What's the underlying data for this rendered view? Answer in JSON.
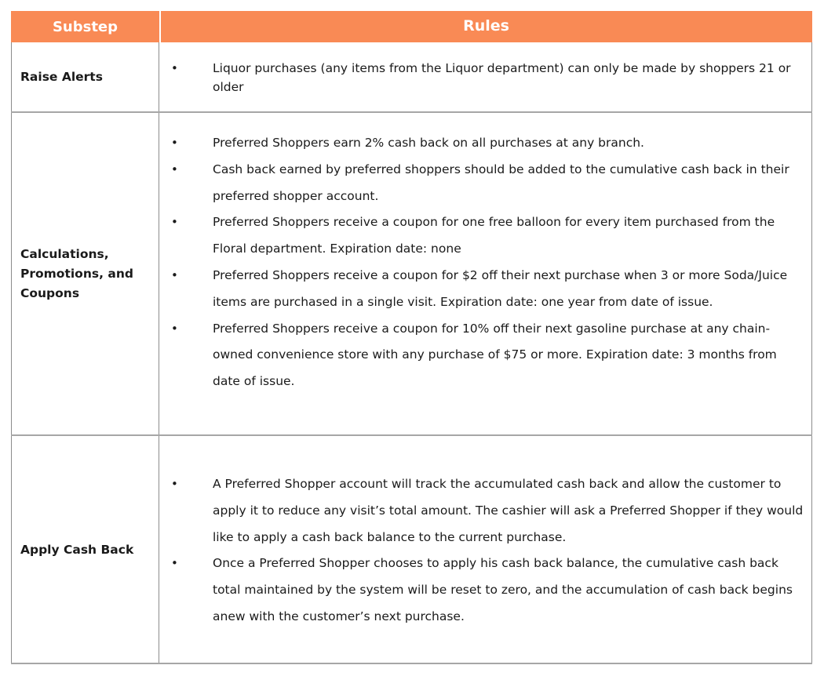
{
  "header": {
    "substep": "Substep",
    "rules": "Rules"
  },
  "rows": [
    {
      "substep": "Raise Alerts",
      "rules": [
        "Liquor purchases (any items from the Liquor department) can only be made by shoppers 21 or older"
      ]
    },
    {
      "substep": "Calculations, Promotions, and Coupons",
      "rules": [
        "Preferred Shoppers earn 2% cash back on all purchases at any branch.",
        "Cash back earned by preferred shoppers should be added to the cumulative cash back in their preferred shopper account.",
        "Preferred Shoppers receive a coupon for one free balloon for every item purchased from the Floral department. Expiration date: none",
        "Preferred Shoppers receive a coupon for $2 off their next purchase when 3 or more Soda/Juice items are purchased in a single visit. Expiration date: one year from date of issue.",
        "Preferred Shoppers receive a coupon for 10% off their next gasoline purchase at any chain-owned convenience store with any purchase of $75 or more. Expiration date: 3 months from date of issue."
      ]
    },
    {
      "substep": "Apply Cash Back",
      "rules": [
        "A Preferred Shopper account will track the accumulated cash back and allow the customer to apply it to reduce any visit’s total amount. The cashier will ask a Preferred Shopper if they would like to apply a cash back balance to the current purchase.",
        "Once a Preferred Shopper chooses to apply his cash back balance, the cumulative cash back total maintained by the system will be reset to zero, and the accumulation of cash back begins anew with the customer’s next purchase."
      ]
    }
  ],
  "bullet": "•",
  "colors": {
    "header_bg": "#f98a55",
    "header_text": "#ffffff",
    "border": "#8c8c8c"
  }
}
